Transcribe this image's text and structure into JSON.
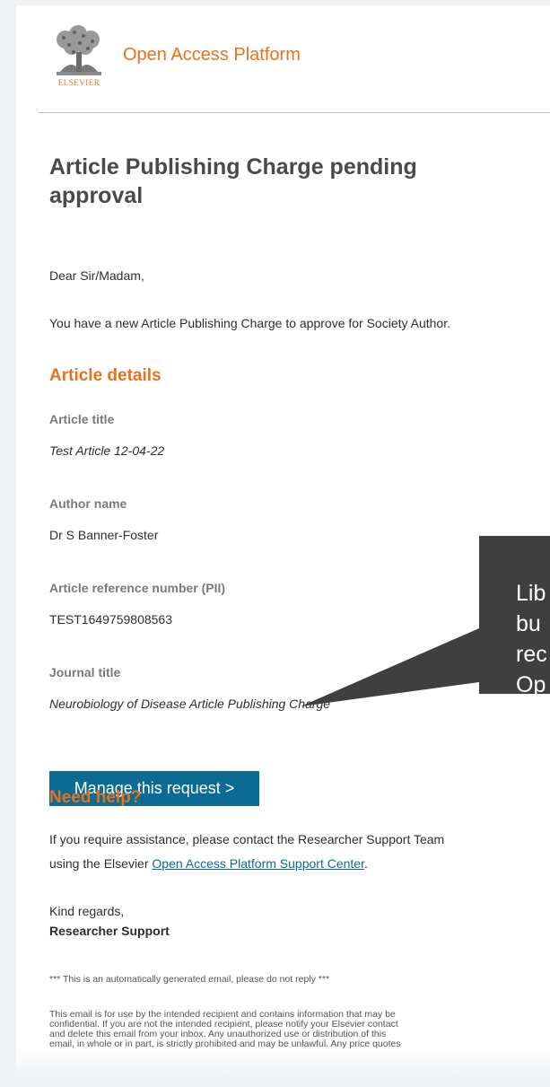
{
  "header": {
    "publisher": "ELSEVIER",
    "platform_name": "Open Access Platform"
  },
  "email": {
    "heading": "Article Publishing Charge pending approval",
    "greeting": "Dear Sir/Madam,",
    "intro": "You have a new Article Publishing Charge to approve for Society Author.",
    "article_details_heading": "Article details",
    "fields": [
      {
        "label": "Article title",
        "value": "Test Article 12-04-22"
      },
      {
        "label": "Author name",
        "value": "Dr S Banner-Foster"
      },
      {
        "label": "Article reference number (PII)",
        "value": "TEST1649759808563"
      },
      {
        "label": "Journal title",
        "value": "Neurobiology of Disease Article Publishing Charge"
      }
    ],
    "manage_button": "Manage this request >",
    "help_heading": "Need help?",
    "help_text_1": "If you require assistance, please contact the Researcher Support Team",
    "help_text_2_prefix": "using the Elsevier ",
    "help_link": "Open Access Platform Support Center",
    "help_text_2_suffix": ".",
    "signoff": "Kind regards,",
    "signature": "Researcher Support",
    "auto_notice": "*** This is an automatically generated email, please do not reply ***",
    "disclaimer_lines": [
      "This email is for use by the intended recipient and contains information that may be",
      "confidential. If you are not the intended recipient, please notify your Elsevier contact",
      "and delete this email from your inbox. Any unauthorized use or distribution of this",
      "email, in whole or in part, is strictly prohibited and may be unlawful. Any price quotes"
    ]
  },
  "callout": {
    "lines": [
      "Lib",
      "bu",
      "rec",
      "Op"
    ]
  },
  "colors": {
    "accent": "#e9711c",
    "button": "#0c6b93",
    "callout": "#3f3f3f"
  }
}
